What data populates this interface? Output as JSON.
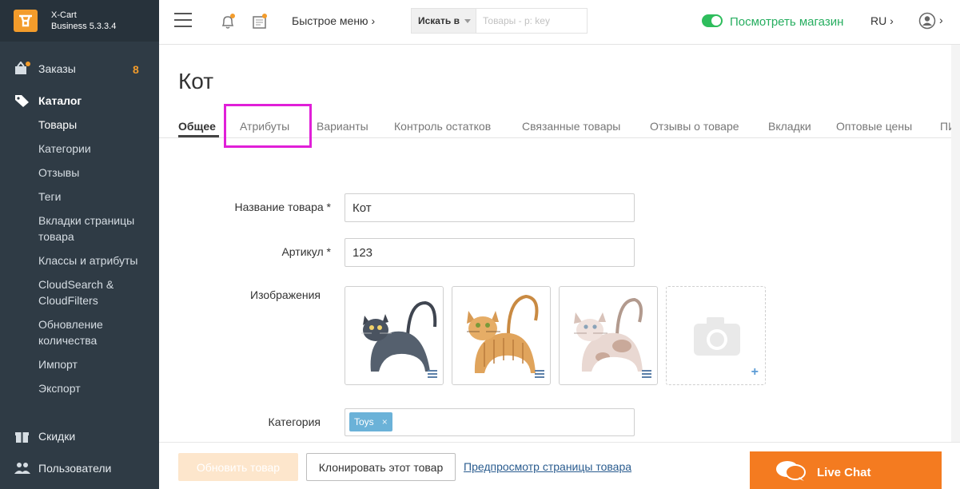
{
  "brand": {
    "name": "X-Cart",
    "edition": "Business 5.3.3.4"
  },
  "sidebar": {
    "orders": {
      "label": "Заказы",
      "count": "8"
    },
    "catalog": {
      "label": "Каталог",
      "items": [
        {
          "label": "Товары"
        },
        {
          "label": "Категории"
        },
        {
          "label": "Отзывы"
        },
        {
          "label": "Теги"
        },
        {
          "label": "Вкладки страницы товара"
        },
        {
          "label": "Классы и атрибуты"
        },
        {
          "label": "CloudSearch & CloudFilters"
        },
        {
          "label": "Обновление количества"
        },
        {
          "label": "Импорт"
        },
        {
          "label": "Экспорт"
        }
      ]
    },
    "discounts": {
      "label": "Скидки"
    },
    "users": {
      "label": "Пользователи"
    }
  },
  "header": {
    "quick_menu": "Быстрое меню ›",
    "search_in": "Искать в",
    "search_placeholder": "Товары - p: key",
    "view_store": "Посмотреть магазин",
    "lang": "RU ›",
    "user_caret": "›"
  },
  "page": {
    "title": "Кот"
  },
  "tabs": [
    {
      "label": "Общее"
    },
    {
      "label": "Атрибуты"
    },
    {
      "label": "Варианты"
    },
    {
      "label": "Контроль остатков"
    },
    {
      "label": "Связанные товары"
    },
    {
      "label": "Отзывы о товаре"
    },
    {
      "label": "Вкладки"
    },
    {
      "label": "Оптовые цены"
    },
    {
      "label": "ПИН"
    }
  ],
  "form": {
    "name_label": "Название товара *",
    "name_value": "Кот",
    "sku_label": "Артикул *",
    "sku_value": "123",
    "images_label": "Изображения",
    "category_label": "Категория",
    "category_chip": "Toys",
    "chip_remove": "×"
  },
  "footer": {
    "update_button": "Обновить товар",
    "clone_button": "Клонировать этот товар",
    "preview_link": "Предпросмотр страницы товара"
  },
  "livechat": {
    "label": "Live Chat"
  },
  "colors": {
    "accent": "#f39c2b",
    "sidebar": "#2f3b45",
    "success": "#27ae60",
    "highlight": "#e01fd8",
    "chat": "#f47b20"
  }
}
